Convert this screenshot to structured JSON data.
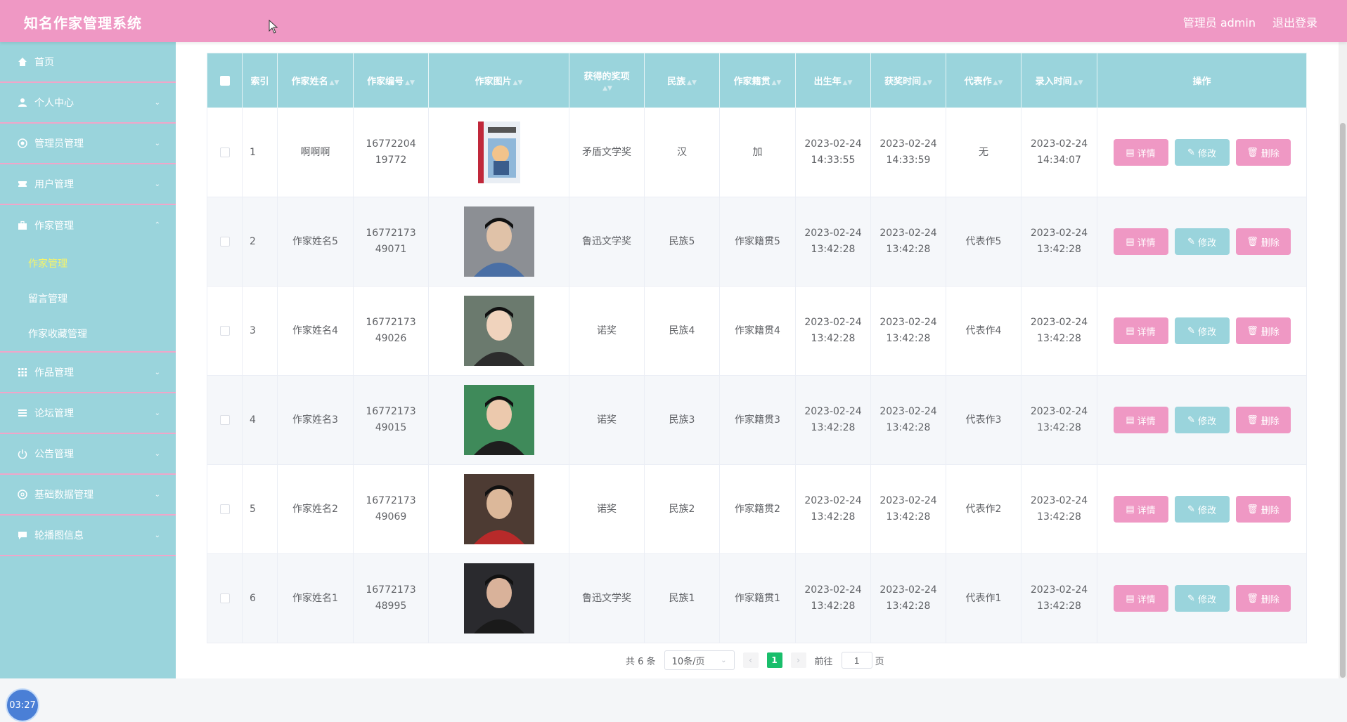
{
  "header": {
    "title": "知名作家管理系统",
    "admin_label": "管理员 admin",
    "logout_label": "退出登录"
  },
  "sidebar": {
    "items": [
      {
        "label": "首页",
        "icon": "home-icon"
      },
      {
        "label": "个人中心",
        "icon": "user-icon"
      },
      {
        "label": "管理员管理",
        "icon": "settings-icon"
      },
      {
        "label": "用户管理",
        "icon": "ticket-icon"
      },
      {
        "label": "作家管理",
        "icon": "briefcase-icon",
        "expanded": true,
        "children": [
          {
            "label": "作家管理",
            "active": true
          },
          {
            "label": "留言管理"
          },
          {
            "label": "作家收藏管理"
          }
        ]
      },
      {
        "label": "作品管理",
        "icon": "grid-icon"
      },
      {
        "label": "论坛管理",
        "icon": "list-icon"
      },
      {
        "label": "公告管理",
        "icon": "power-icon"
      },
      {
        "label": "基础数据管理",
        "icon": "aperture-icon"
      },
      {
        "label": "轮播图信息",
        "icon": "message-icon"
      }
    ]
  },
  "clock": "03:27",
  "table": {
    "headers": [
      "索引",
      "作家姓名",
      "作家编号",
      "作家图片",
      "获得的奖项",
      "民族",
      "作家籍贯",
      "出生年",
      "获奖时间",
      "代表作",
      "录入时间",
      "操作"
    ],
    "rows": [
      {
        "index": "1",
        "name": "啊啊啊",
        "code": "1677220419772",
        "photo": "book-cover",
        "award": "矛盾文学奖",
        "ethnic": "汉",
        "origin": "加",
        "birth": "2023-02-24 14:33:55",
        "award_time": "2023-02-24 14:33:59",
        "work": "无",
        "entry": "2023-02-24 14:34:07"
      },
      {
        "index": "2",
        "name": "作家姓名5",
        "code": "1677217349071",
        "photo": "portrait",
        "award": "鲁迅文学奖",
        "ethnic": "民族5",
        "origin": "作家籍贯5",
        "birth": "2023-02-24 13:42:28",
        "award_time": "2023-02-24 13:42:28",
        "work": "代表作5",
        "entry": "2023-02-24 13:42:28"
      },
      {
        "index": "3",
        "name": "作家姓名4",
        "code": "1677217349026",
        "photo": "portrait",
        "award": "诺奖",
        "ethnic": "民族4",
        "origin": "作家籍贯4",
        "birth": "2023-02-24 13:42:28",
        "award_time": "2023-02-24 13:42:28",
        "work": "代表作4",
        "entry": "2023-02-24 13:42:28"
      },
      {
        "index": "4",
        "name": "作家姓名3",
        "code": "1677217349015",
        "photo": "portrait",
        "award": "诺奖",
        "ethnic": "民族3",
        "origin": "作家籍贯3",
        "birth": "2023-02-24 13:42:28",
        "award_time": "2023-02-24 13:42:28",
        "work": "代表作3",
        "entry": "2023-02-24 13:42:28"
      },
      {
        "index": "5",
        "name": "作家姓名2",
        "code": "1677217349069",
        "photo": "portrait",
        "award": "诺奖",
        "ethnic": "民族2",
        "origin": "作家籍贯2",
        "birth": "2023-02-24 13:42:28",
        "award_time": "2023-02-24 13:42:28",
        "work": "代表作2",
        "entry": "2023-02-24 13:42:28"
      },
      {
        "index": "6",
        "name": "作家姓名1",
        "code": "1677217348995",
        "photo": "portrait",
        "award": "鲁迅文学奖",
        "ethnic": "民族1",
        "origin": "作家籍贯1",
        "birth": "2023-02-24 13:42:28",
        "award_time": "2023-02-24 13:42:28",
        "work": "代表作1",
        "entry": "2023-02-24 13:42:28"
      }
    ],
    "actions": {
      "detail": "详情",
      "edit": "修改",
      "delete": "删除"
    }
  },
  "pagination": {
    "total": "共 6 条",
    "page_size": "10条/页",
    "current": "1",
    "goto_prefix": "前往",
    "goto_value": "1",
    "goto_suffix": "页"
  },
  "colors": {
    "pink": "#ef98c4",
    "teal": "#9ad4dc",
    "active_sub": "#f5f36a",
    "page_active": "#19be6b"
  }
}
